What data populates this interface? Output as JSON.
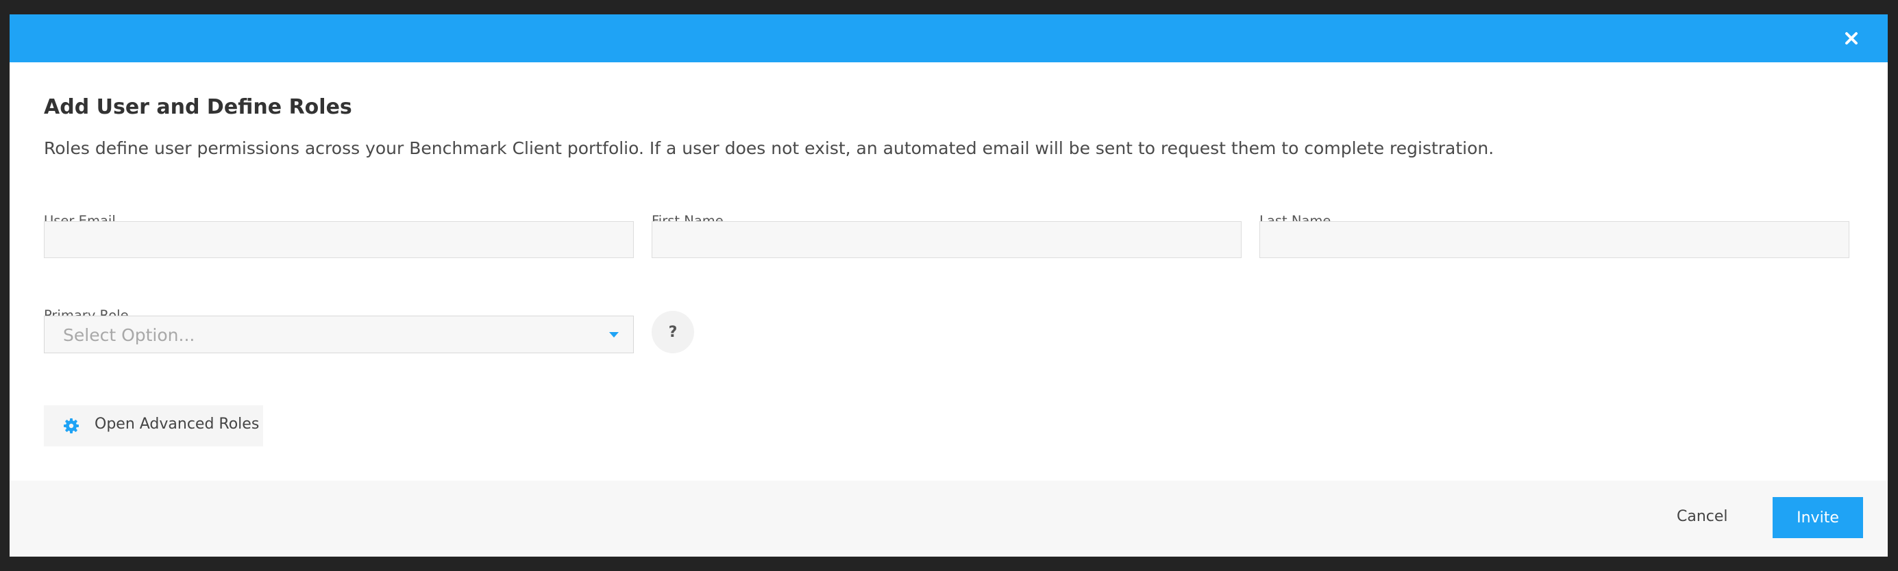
{
  "modal": {
    "title": "Add User and Define Roles",
    "description": "Roles define user permissions across your Benchmark Client portfolio. If a user does not exist, an automated email will be sent to request them to complete registration.",
    "header_color": "#1fa3f5"
  },
  "form": {
    "email": {
      "label": "User Email",
      "value": "",
      "placeholder": ""
    },
    "first_name": {
      "label": "First Name",
      "value": "",
      "placeholder": ""
    },
    "last_name": {
      "label": "Last Name",
      "value": "",
      "placeholder": ""
    },
    "primary_role": {
      "label": "Primary Role",
      "selected": "Select Option..."
    },
    "help_label": "?"
  },
  "advanced": {
    "label": "Open Advanced Roles",
    "icon": "gear-icon"
  },
  "footer": {
    "cancel_label": "Cancel",
    "invite_label": "Invite"
  },
  "colors": {
    "accent": "#1fa3f5",
    "backdrop": "#232323"
  }
}
